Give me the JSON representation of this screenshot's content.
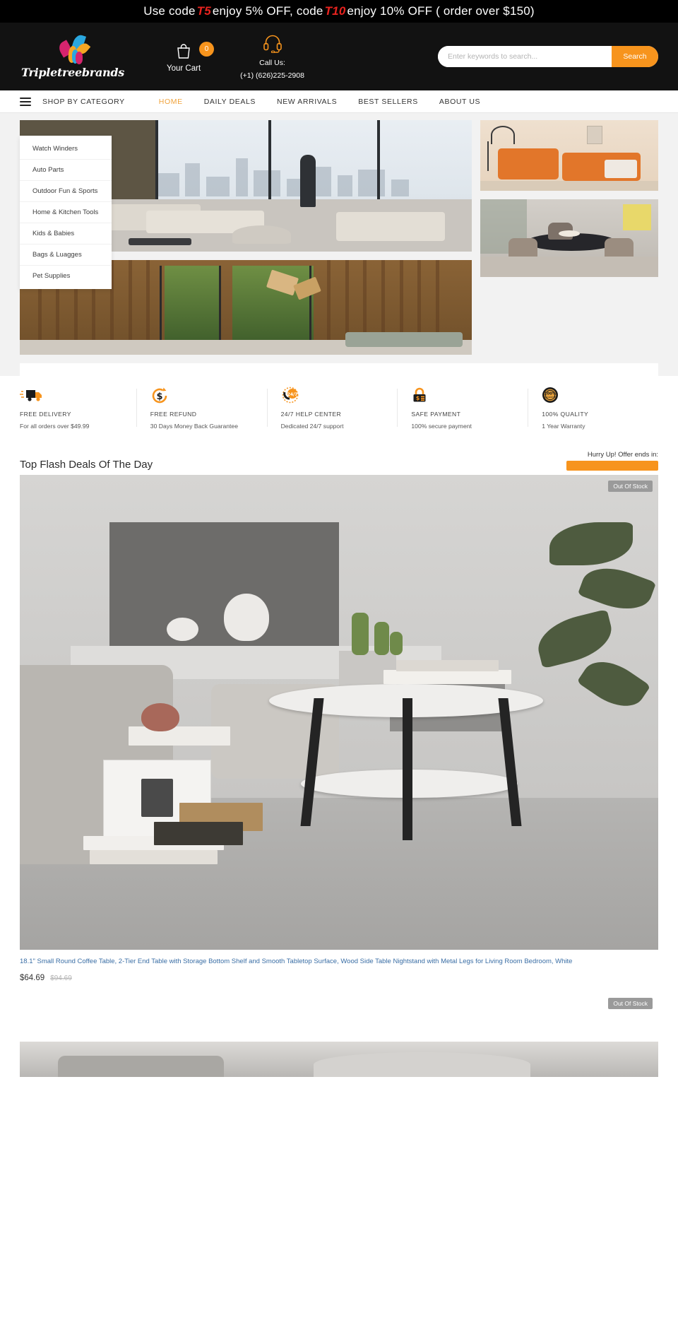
{
  "promo": {
    "prefix": "Use code ",
    "code1": "T5",
    "mid1": " enjoy 5% OFF, code ",
    "code2": "T10",
    "mid2": " enjoy 10% OFF ( order over $150)",
    "code_color": "#e8231f"
  },
  "header": {
    "logo_text": "Tripletreebrands",
    "cart_label": "Your Cart",
    "cart_count": "0",
    "call_label": "Call Us:",
    "call_number": "(+1) (626)225-2908",
    "search_placeholder": "Enter keywords to search...",
    "search_button": "Search",
    "accent": "#f7941d",
    "background": "#121212"
  },
  "nav": {
    "category_label": "SHOP BY CATEGORY",
    "items": [
      {
        "label": "HOME",
        "active": true
      },
      {
        "label": "DAILY DEALS",
        "active": false
      },
      {
        "label": "NEW ARRIVALS",
        "active": false
      },
      {
        "label": "BEST SELLERS",
        "active": false
      },
      {
        "label": "ABOUT US",
        "active": false
      }
    ],
    "active_color": "#f0a33c"
  },
  "category_menu": {
    "items": [
      {
        "label": "Watch Winders"
      },
      {
        "label": "Auto Parts"
      },
      {
        "label": "Outdoor Fun & Sports"
      },
      {
        "label": "Home & Kitchen Tools"
      },
      {
        "label": "Kids & Babies"
      },
      {
        "label": "Bags & Luagges"
      },
      {
        "label": "Pet Supplies"
      }
    ]
  },
  "services": [
    {
      "icon": "delivery-truck-icon",
      "title": "FREE DELIVERY",
      "subtitle": "For all orders over $49.99"
    },
    {
      "icon": "refund-dollar-icon",
      "title": "FREE REFUND",
      "subtitle": "30 Days Money Back Guarantee"
    },
    {
      "icon": "help-center-247-icon",
      "title": "24/7 HELP CENTER",
      "subtitle": "Dedicated 24/7 support"
    },
    {
      "icon": "lock-payment-icon",
      "title": "SAFE PAYMENT",
      "subtitle": "100% secure payment"
    },
    {
      "icon": "quality-badge-icon",
      "title": "100% QUALITY",
      "subtitle": "1 Year Warranty"
    }
  ],
  "flash": {
    "title": "Top Flash Deals Of The Day",
    "hurry_text": "Hurry Up! Offer ends in:",
    "countdown_color": "#f7941d"
  },
  "deals": [
    {
      "badge": "Out Of Stock",
      "title": "18.1\" Small Round Coffee Table, 2-Tier End Table with Storage Bottom Shelf and Smooth Tabletop Surface, Wood Side Table Nightstand with Metal Legs for Living Room Bedroom, White",
      "price": "$64.69",
      "old_price": "$94.69"
    },
    {
      "badge": "Out Of Stock",
      "title": "",
      "price": "",
      "old_price": ""
    }
  ]
}
